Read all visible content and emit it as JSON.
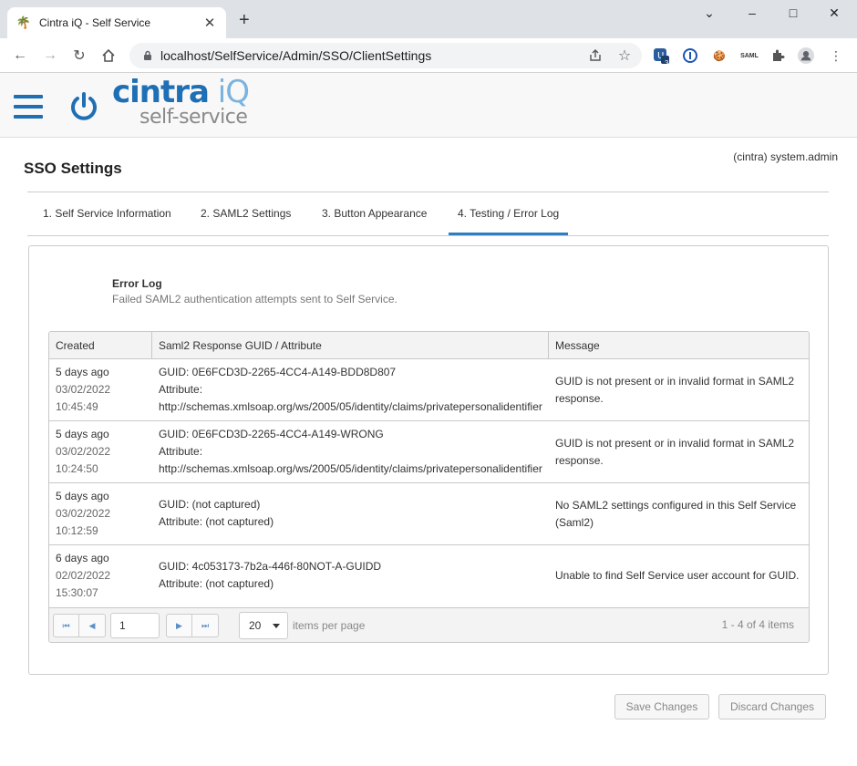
{
  "browser": {
    "tab_title": "Cintra iQ - Self Service",
    "url": "localhost/SelfService/Admin/SSO/ClientSettings",
    "extension_badge": "3",
    "saml_ext_label": "SAML"
  },
  "header": {
    "logo_main": "cintra",
    "logo_iq": " iQ",
    "logo_sub": "self-service"
  },
  "page": {
    "user": "(cintra) system.admin",
    "title": "SSO Settings"
  },
  "tabs": [
    {
      "label": "1. Self Service Information"
    },
    {
      "label": "2. SAML2 Settings"
    },
    {
      "label": "3. Button Appearance"
    },
    {
      "label": "4. Testing / Error Log"
    }
  ],
  "section": {
    "title": "Error Log",
    "description": "Failed SAML2 authentication attempts sent to Self Service."
  },
  "grid": {
    "columns": [
      "Created",
      "Saml2 Response GUID / Attribute",
      "Message"
    ],
    "rows": [
      {
        "ago": "5 days ago",
        "date": "03/02/2022",
        "time": "10:45:49",
        "guid": "GUID: 0E6FCD3D-2265-4CC4-A149-BDD8D807",
        "attr_label": "Attribute:",
        "attr_value": "http://schemas.xmlsoap.org/ws/2005/05/identity/claims/privatepersonalidentifier",
        "message": "GUID is not present or in invalid format in SAML2 response."
      },
      {
        "ago": "5 days ago",
        "date": "03/02/2022",
        "time": "10:24:50",
        "guid": "GUID: 0E6FCD3D-2265-4CC4-A149-WRONG",
        "attr_label": "Attribute:",
        "attr_value": "http://schemas.xmlsoap.org/ws/2005/05/identity/claims/privatepersonalidentifier",
        "message": "GUID is not present or in invalid format in SAML2 response."
      },
      {
        "ago": "5 days ago",
        "date": "03/02/2022",
        "time": "10:12:59",
        "guid": "GUID: (not captured)",
        "attr_label": "Attribute: (not captured)",
        "attr_value": "",
        "message": "No SAML2 settings configured in this Self Service (Saml2)"
      },
      {
        "ago": "6 days ago",
        "date": "02/02/2022",
        "time": "15:30:07",
        "guid": "GUID: 4c053173-7b2a-446f-80NOT-A-GUIDD",
        "attr_label": "Attribute: (not captured)",
        "attr_value": "",
        "message": "Unable to find Self Service user account for GUID."
      }
    ],
    "pager": {
      "page": "1",
      "page_size": "20",
      "items_per_page": "items per page",
      "info": "1 - 4 of 4 items"
    }
  },
  "actions": {
    "save": "Save Changes",
    "discard": "Discard Changes"
  }
}
